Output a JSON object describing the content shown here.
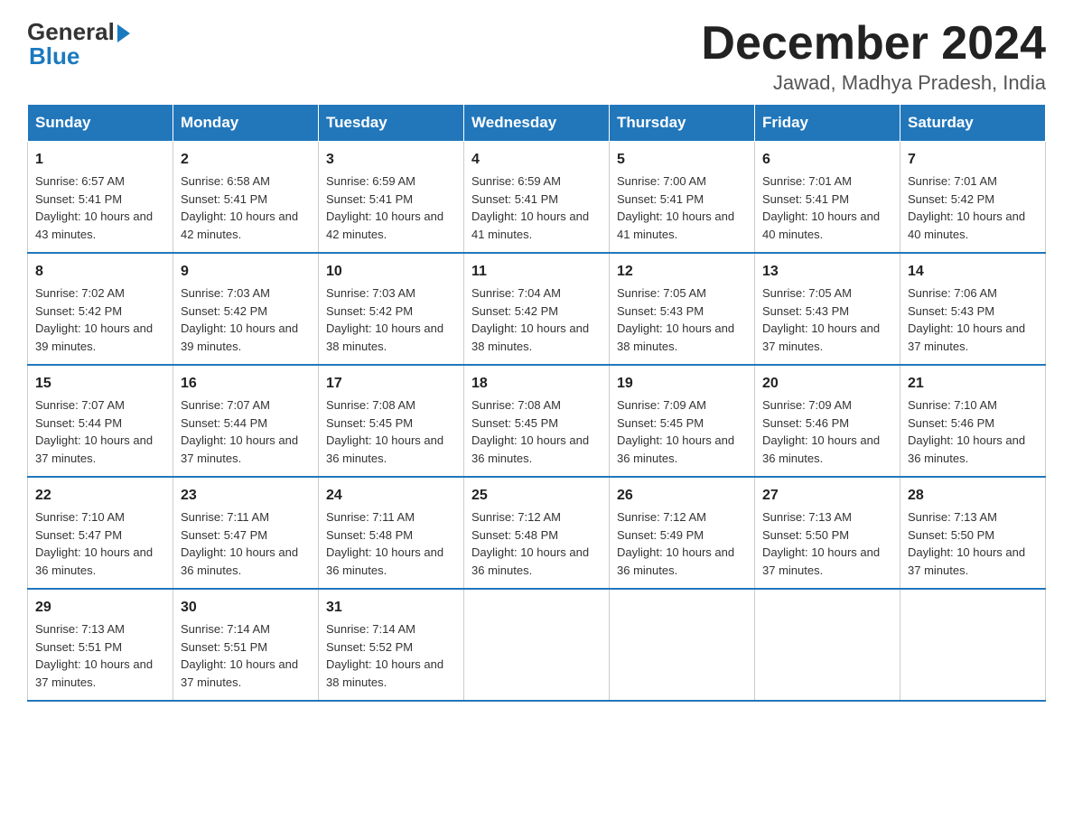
{
  "logo": {
    "general": "General",
    "blue": "Blue"
  },
  "title": "December 2024",
  "location": "Jawad, Madhya Pradesh, India",
  "weekdays": [
    "Sunday",
    "Monday",
    "Tuesday",
    "Wednesday",
    "Thursday",
    "Friday",
    "Saturday"
  ],
  "weeks": [
    [
      {
        "day": "1",
        "sunrise": "6:57 AM",
        "sunset": "5:41 PM",
        "daylight": "10 hours and 43 minutes."
      },
      {
        "day": "2",
        "sunrise": "6:58 AM",
        "sunset": "5:41 PM",
        "daylight": "10 hours and 42 minutes."
      },
      {
        "day": "3",
        "sunrise": "6:59 AM",
        "sunset": "5:41 PM",
        "daylight": "10 hours and 42 minutes."
      },
      {
        "day": "4",
        "sunrise": "6:59 AM",
        "sunset": "5:41 PM",
        "daylight": "10 hours and 41 minutes."
      },
      {
        "day": "5",
        "sunrise": "7:00 AM",
        "sunset": "5:41 PM",
        "daylight": "10 hours and 41 minutes."
      },
      {
        "day": "6",
        "sunrise": "7:01 AM",
        "sunset": "5:41 PM",
        "daylight": "10 hours and 40 minutes."
      },
      {
        "day": "7",
        "sunrise": "7:01 AM",
        "sunset": "5:42 PM",
        "daylight": "10 hours and 40 minutes."
      }
    ],
    [
      {
        "day": "8",
        "sunrise": "7:02 AM",
        "sunset": "5:42 PM",
        "daylight": "10 hours and 39 minutes."
      },
      {
        "day": "9",
        "sunrise": "7:03 AM",
        "sunset": "5:42 PM",
        "daylight": "10 hours and 39 minutes."
      },
      {
        "day": "10",
        "sunrise": "7:03 AM",
        "sunset": "5:42 PM",
        "daylight": "10 hours and 38 minutes."
      },
      {
        "day": "11",
        "sunrise": "7:04 AM",
        "sunset": "5:42 PM",
        "daylight": "10 hours and 38 minutes."
      },
      {
        "day": "12",
        "sunrise": "7:05 AM",
        "sunset": "5:43 PM",
        "daylight": "10 hours and 38 minutes."
      },
      {
        "day": "13",
        "sunrise": "7:05 AM",
        "sunset": "5:43 PM",
        "daylight": "10 hours and 37 minutes."
      },
      {
        "day": "14",
        "sunrise": "7:06 AM",
        "sunset": "5:43 PM",
        "daylight": "10 hours and 37 minutes."
      }
    ],
    [
      {
        "day": "15",
        "sunrise": "7:07 AM",
        "sunset": "5:44 PM",
        "daylight": "10 hours and 37 minutes."
      },
      {
        "day": "16",
        "sunrise": "7:07 AM",
        "sunset": "5:44 PM",
        "daylight": "10 hours and 37 minutes."
      },
      {
        "day": "17",
        "sunrise": "7:08 AM",
        "sunset": "5:45 PM",
        "daylight": "10 hours and 36 minutes."
      },
      {
        "day": "18",
        "sunrise": "7:08 AM",
        "sunset": "5:45 PM",
        "daylight": "10 hours and 36 minutes."
      },
      {
        "day": "19",
        "sunrise": "7:09 AM",
        "sunset": "5:45 PM",
        "daylight": "10 hours and 36 minutes."
      },
      {
        "day": "20",
        "sunrise": "7:09 AM",
        "sunset": "5:46 PM",
        "daylight": "10 hours and 36 minutes."
      },
      {
        "day": "21",
        "sunrise": "7:10 AM",
        "sunset": "5:46 PM",
        "daylight": "10 hours and 36 minutes."
      }
    ],
    [
      {
        "day": "22",
        "sunrise": "7:10 AM",
        "sunset": "5:47 PM",
        "daylight": "10 hours and 36 minutes."
      },
      {
        "day": "23",
        "sunrise": "7:11 AM",
        "sunset": "5:47 PM",
        "daylight": "10 hours and 36 minutes."
      },
      {
        "day": "24",
        "sunrise": "7:11 AM",
        "sunset": "5:48 PM",
        "daylight": "10 hours and 36 minutes."
      },
      {
        "day": "25",
        "sunrise": "7:12 AM",
        "sunset": "5:48 PM",
        "daylight": "10 hours and 36 minutes."
      },
      {
        "day": "26",
        "sunrise": "7:12 AM",
        "sunset": "5:49 PM",
        "daylight": "10 hours and 36 minutes."
      },
      {
        "day": "27",
        "sunrise": "7:13 AM",
        "sunset": "5:50 PM",
        "daylight": "10 hours and 37 minutes."
      },
      {
        "day": "28",
        "sunrise": "7:13 AM",
        "sunset": "5:50 PM",
        "daylight": "10 hours and 37 minutes."
      }
    ],
    [
      {
        "day": "29",
        "sunrise": "7:13 AM",
        "sunset": "5:51 PM",
        "daylight": "10 hours and 37 minutes."
      },
      {
        "day": "30",
        "sunrise": "7:14 AM",
        "sunset": "5:51 PM",
        "daylight": "10 hours and 37 minutes."
      },
      {
        "day": "31",
        "sunrise": "7:14 AM",
        "sunset": "5:52 PM",
        "daylight": "10 hours and 38 minutes."
      },
      null,
      null,
      null,
      null
    ]
  ]
}
